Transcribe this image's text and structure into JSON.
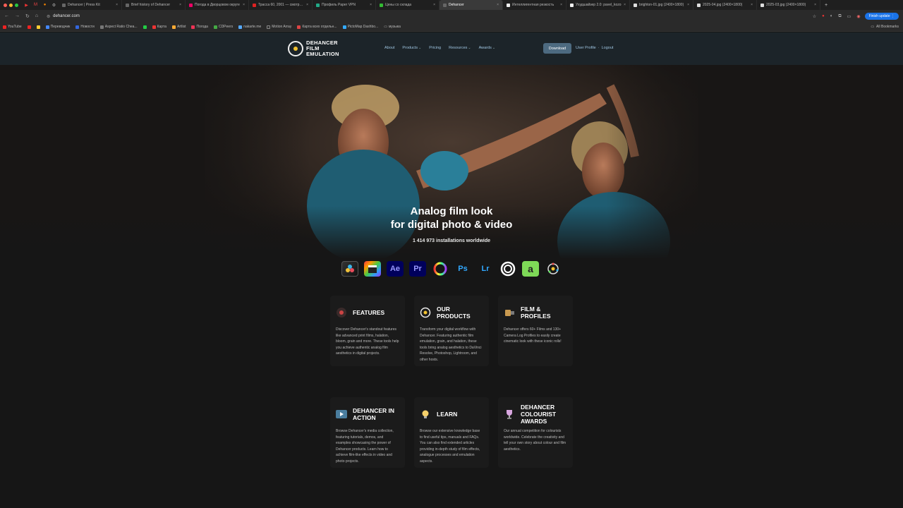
{
  "browser": {
    "tabs": [
      {
        "title": "Dehancer | Press Kit"
      },
      {
        "title": "Brief history of Dehancer"
      },
      {
        "title": "Погода в Дворцовом округе"
      },
      {
        "title": "Трасса 60, 2001 — смотреть"
      },
      {
        "title": "Профиль Paper VPN"
      },
      {
        "title": "Цены со склада"
      },
      {
        "title": "Dehancer",
        "active": true
      },
      {
        "title": "Интеллигентная резкость"
      },
      {
        "title": "Ухудшайзер 2.0: pavel_kozo"
      },
      {
        "title": "brighton-01.jpg (2400×1800)"
      },
      {
        "title": "2025-04.jpg (2400×1800)"
      },
      {
        "title": "2025-03.jpg (2400×1800)"
      }
    ],
    "url": "dehancer.com",
    "finish_update": "Finish update",
    "bookmarks": [
      "YouTube",
      "Переводчик",
      "Новости",
      "Aspect Ratio Chea...",
      "Карта",
      "Artlist",
      "Погода",
      "CDPeers",
      "nakarte.me",
      "Motion Array",
      "Карта всех отдельн...",
      "PictoMap Dashbo...",
      "музыка"
    ],
    "all_bookmarks": "All Bookmarks"
  },
  "site": {
    "logo": {
      "line1": "DEHANCER",
      "line2": "FILM",
      "line3": "EMULATION"
    },
    "nav": {
      "about": "About",
      "products": "Products",
      "pricing": "Pricing",
      "resources": "Resources",
      "awards": "Awards"
    },
    "download": "Download",
    "user_profile": "User Profile",
    "separator": "·",
    "logout": "Logout",
    "hero": {
      "title_line1": "Analog film look",
      "title_line2": "for digital photo & video",
      "installs": "1 414 973 installations worldwide"
    },
    "apps": [
      {
        "name": "resolve-icon",
        "label": ""
      },
      {
        "name": "final-cut-icon",
        "label": ""
      },
      {
        "name": "after-effects-icon",
        "label": "Ae"
      },
      {
        "name": "premiere-icon",
        "label": "Pr"
      },
      {
        "name": "ofx-icon",
        "label": ""
      },
      {
        "name": "photoshop-icon",
        "label": "Ps"
      },
      {
        "name": "lightroom-icon",
        "label": "Lr"
      },
      {
        "name": "capture-one-icon",
        "label": ""
      },
      {
        "name": "affinity-icon",
        "label": "a"
      },
      {
        "name": "dehancer-app-icon",
        "label": ""
      }
    ],
    "cards": [
      {
        "title": "Features",
        "body": "Discover Dehancer's standout features like advanced print films, halation, bloom, grain and more. These tools help you achieve authentic analog film aesthetics in digital projects."
      },
      {
        "title": "Our Products",
        "body": "Transform your digital workflow with Dehancer. Featuring authentic film emulation, grain, and halation, these tools bring analog aesthetics to DaVinci Resolve, Photoshop, Lightroom, and other hosts."
      },
      {
        "title": "Film & Profiles",
        "body": "Dehancer offers 60+ Films and 130+ Camera Log Profiles to easily create cinematic look with these iconic rolls!"
      },
      {
        "title": "Dehancer in Action",
        "body": "Browse Dehancer's media collection, featuring tutorials, demos, and examples showcasing the power of Dehancer products. Learn how to achieve film-like effects in video and photo projects."
      },
      {
        "title": "Learn",
        "body": "Browse our extensive knowledge base to find useful tips, manuals and FAQs. You can also find extended articles providing in-depth study of film effects, analogue processes and emulation aspects."
      },
      {
        "title": "Dehancer Colourist Awards",
        "body": "Our annual competition for colourists worldwide. Celebrate the creativity and tell your own story about colour and film aesthetics."
      }
    ]
  }
}
